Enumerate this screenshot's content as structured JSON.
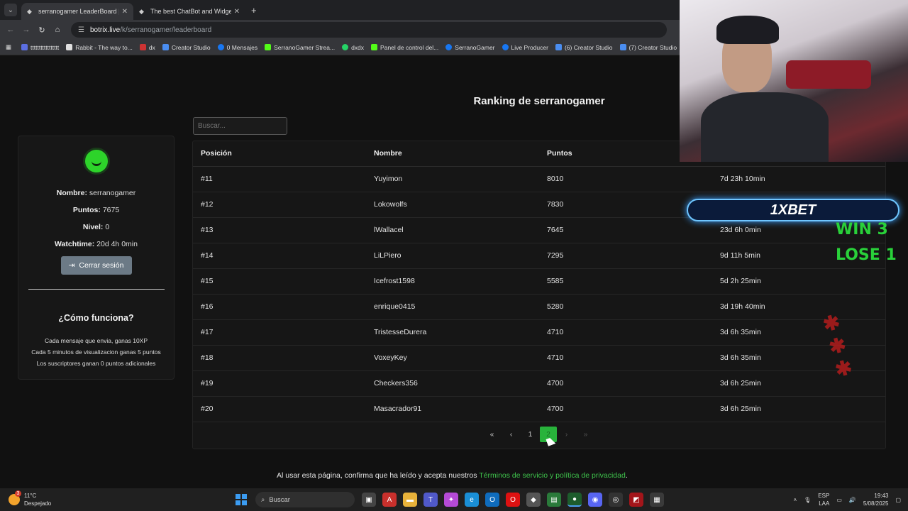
{
  "browser": {
    "tabs": [
      {
        "title": "serranogamer LeaderBoard | Th",
        "active": true
      },
      {
        "title": "The best ChatBot and Widgets",
        "active": false
      }
    ],
    "new_tab": "+",
    "url_host": "botrix.live",
    "url_path": "/k/serranogamer/leaderboard",
    "bookmarks": [
      {
        "label": "ttttttttttttttttt",
        "color": "#5b6ee1"
      },
      {
        "label": "Rabbit - The way to...",
        "color": "#e0e0e0"
      },
      {
        "label": "dx",
        "color": "#c33"
      },
      {
        "label": "Creator Studio",
        "color": "#4a8df0"
      },
      {
        "label": "0 Mensajes",
        "color": "#1877f2"
      },
      {
        "label": "SerranoGamer Strea...",
        "color": "#53fc18"
      },
      {
        "label": "dxdx",
        "color": "#25d366"
      },
      {
        "label": "Panel de control del...",
        "color": "#53fc18"
      },
      {
        "label": "SerranoGamer",
        "color": "#1877f2"
      },
      {
        "label": "Live Producer",
        "color": "#1877f2"
      },
      {
        "label": "(6) Creator Studio",
        "color": "#4a8df0"
      },
      {
        "label": "(7) Creator Studio",
        "color": "#4a8df0"
      }
    ]
  },
  "page": {
    "title": "Ranking de serranogamer",
    "search_placeholder": "Buscar..."
  },
  "profile": {
    "name_label": "Nombre:",
    "name_value": "serranogamer",
    "points_label": "Puntos:",
    "points_value": "7675",
    "level_label": "Nivel:",
    "level_value": "0",
    "watch_label": "Watchtime:",
    "watch_value": "20d 4h 0min",
    "logout_label": "Cerrar sesión",
    "how_title": "¿Cómo funciona?",
    "how_lines": [
      "Cada mensaje que envia, ganas 10XP",
      "Cada 5 minutos de visualizacion ganas 5 puntos",
      "Los suscriptores ganan 0 puntos adicionales"
    ]
  },
  "table": {
    "headers": [
      "Posición",
      "Nombre",
      "Puntos",
      ""
    ],
    "rows": [
      [
        "#11",
        "Yuyimon",
        "8010",
        "7d 23h 10min"
      ],
      [
        "#12",
        "Lokowolfs",
        "7830",
        ""
      ],
      [
        "#13",
        "lWallacel",
        "7645",
        "23d 6h 0min"
      ],
      [
        "#14",
        "LiLPiero",
        "7295",
        "9d 11h 5min"
      ],
      [
        "#15",
        "Icefrost1598",
        "5585",
        "5d 2h 25min"
      ],
      [
        "#16",
        "enrique0415",
        "5280",
        "3d 19h 40min"
      ],
      [
        "#17",
        "TristesseDurera",
        "4710",
        "3d 6h 35min"
      ],
      [
        "#18",
        "VoxeyKey",
        "4710",
        "3d 6h 35min"
      ],
      [
        "#19",
        "Checkers356",
        "4700",
        "3d 6h 25min"
      ],
      [
        "#20",
        "Masacrador91",
        "4700",
        "3d 6h 25min"
      ]
    ]
  },
  "pagination": {
    "first": "«",
    "prev": "‹",
    "pages": [
      "1",
      "2"
    ],
    "current": "2",
    "next": "›",
    "last": "»"
  },
  "footer": {
    "text": "Al usar esta página, confirma que ha leído y acepta nuestros ",
    "link": "Términos de servicio y política de privacidad",
    "end": "."
  },
  "overlay": {
    "bet_brand": "1XBET",
    "win": "WIN 3",
    "lose": "LOSE 1"
  },
  "taskbar": {
    "weather_temp": "11°C",
    "weather_desc": "Despejado",
    "weather_badge": "3",
    "search_label": "Buscar",
    "lang": "ESP",
    "lang2": "LAA",
    "time": "19:43",
    "date": "5/08/2025"
  },
  "colors": {
    "accent": "#28b33b",
    "link": "#3ec24b",
    "background": "#111111"
  }
}
